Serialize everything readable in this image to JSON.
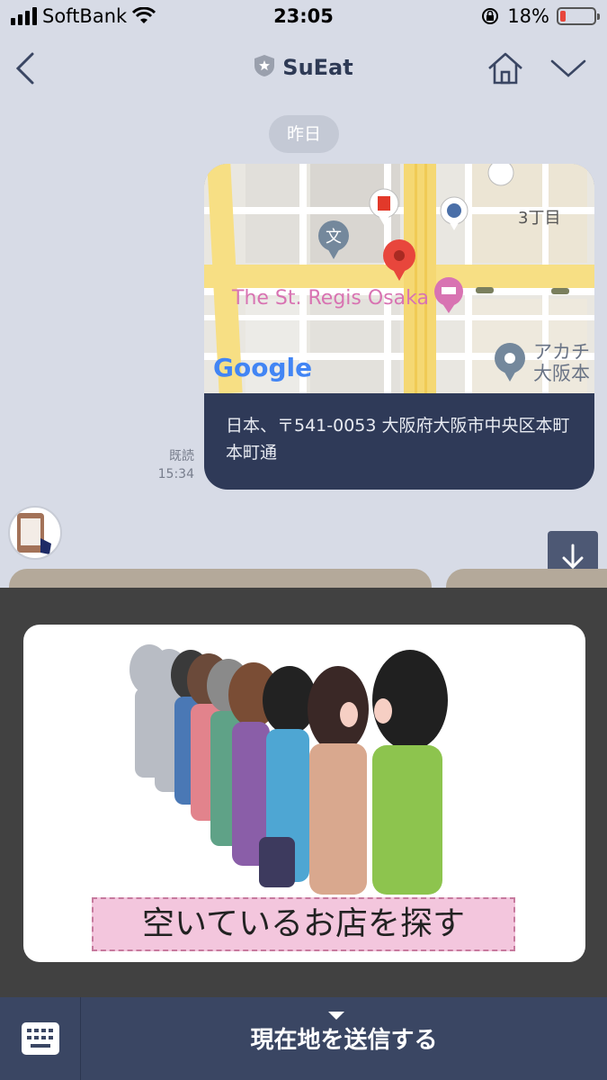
{
  "status_bar": {
    "carrier": "SoftBank",
    "time": "23:05",
    "battery": "18%",
    "battery_level": 0.18
  },
  "nav": {
    "title": "SuEat",
    "icons": [
      "back-chevron",
      "shield-star",
      "home",
      "chevron-down"
    ]
  },
  "chat": {
    "date_label": "昨日",
    "location_message": {
      "address": "日本、〒541-0053 大阪府大阪市中央区本町 本町通",
      "read_label": "既読",
      "time": "15:34",
      "map": {
        "labels": [
          "The St. Regis Osaka",
          "3丁目",
          "アカチ",
          "大阪本",
          "文"
        ],
        "attribution": "Google"
      }
    }
  },
  "rich_menu": {
    "caption": "空いているお店を探す"
  },
  "bottom_bar": {
    "send_location": "現在地を送信する"
  },
  "colors": {
    "background": "#d7dbe6",
    "header_text": "#2e3a55",
    "bubble": "#2f3a58",
    "rich_menu_bg": "#414141",
    "bottom_bar": "#3a4663",
    "caption_bg": "#f3c6dd"
  }
}
